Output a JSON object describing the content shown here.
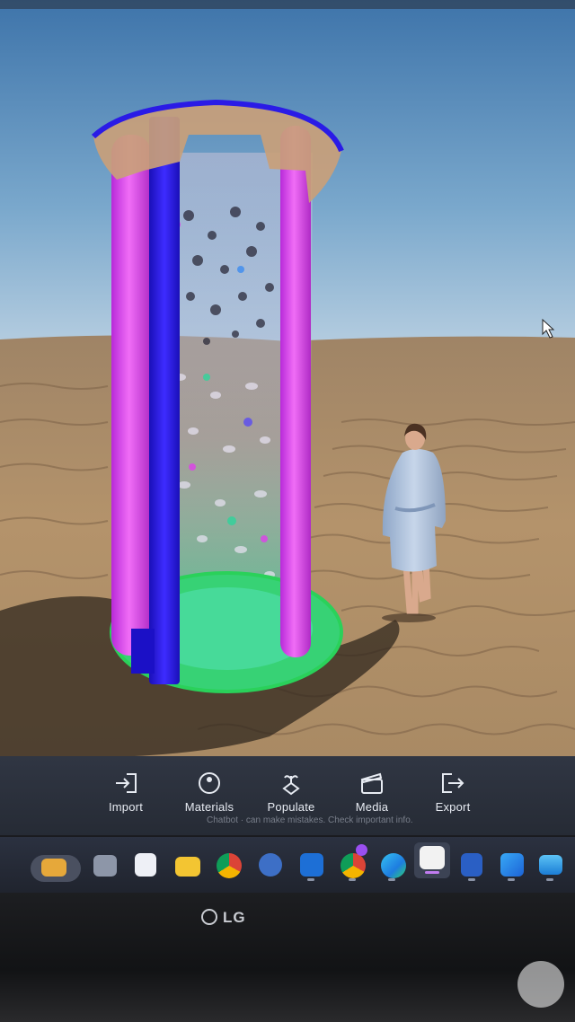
{
  "toolbar": {
    "items": [
      {
        "label": "Import",
        "icon": "import-icon"
      },
      {
        "label": "Materials",
        "icon": "materials-icon"
      },
      {
        "label": "Populate",
        "icon": "populate-icon"
      },
      {
        "label": "Media",
        "icon": "media-icon"
      },
      {
        "label": "Export",
        "icon": "export-icon"
      }
    ],
    "notice": "Chatbot · can make mistakes. Check important info."
  },
  "taskbar": {
    "apps": [
      "briefcase-icon",
      "stack-icon",
      "photo-editor-icon",
      "folder-icon",
      "chrome-icon",
      "settings-icon",
      "outlook-icon",
      "chrome-profile-icon",
      "edge-icon",
      "twinmotion-icon",
      "sketchup-icon",
      "photos-icon",
      "image-viewer-icon"
    ]
  },
  "monitor": {
    "brand": "LG"
  },
  "colors": {
    "sky": "#6a9cc3",
    "sand": "#b2916a",
    "pillar_magenta": "#e43ce8",
    "pillar_blue": "#2a1be6",
    "base_green": "#3fe07b"
  }
}
